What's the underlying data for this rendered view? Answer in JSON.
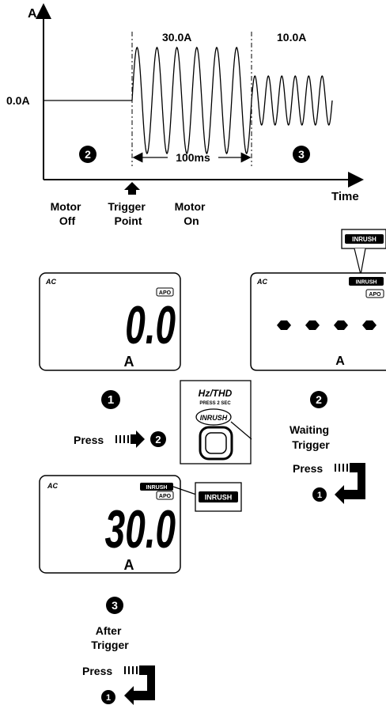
{
  "waveform": {
    "y_axis_label": "A",
    "x_axis_label": "Time",
    "zero_label": "0.0A",
    "amp1_label": "30.0A",
    "amp2_label": "10.0A",
    "duration_label": "100ms",
    "step_off_num": "2",
    "step_on_num": "3",
    "motor_off": [
      "Motor",
      "Off"
    ],
    "trigger_point": [
      "Trigger",
      "Point"
    ],
    "motor_on": [
      "Motor",
      "On"
    ]
  },
  "display1": {
    "mode": "AC",
    "apo": "APO",
    "reading": "0.0",
    "unit": "A",
    "step_num": "1",
    "press_label": "Press",
    "next_num": "2"
  },
  "button_panel": {
    "title": "Hz/THD",
    "subtitle": "PRESS 2 SEC",
    "inrush": "INRUSH"
  },
  "display2": {
    "mode": "AC",
    "inrush": "INRUSH",
    "callout": "INRUSH",
    "apo": "APO",
    "unit": "A",
    "step_num": "2",
    "status": [
      "Waiting",
      "Trigger"
    ],
    "press_label": "Press",
    "back_num": "1"
  },
  "display3": {
    "mode": "AC",
    "inrush": "INRUSH",
    "callout": "INRUSH",
    "apo": "APO",
    "reading": "30.0",
    "unit": "A",
    "step_num": "3",
    "status": [
      "After",
      "Trigger"
    ],
    "press_label": "Press",
    "back_num": "1"
  }
}
